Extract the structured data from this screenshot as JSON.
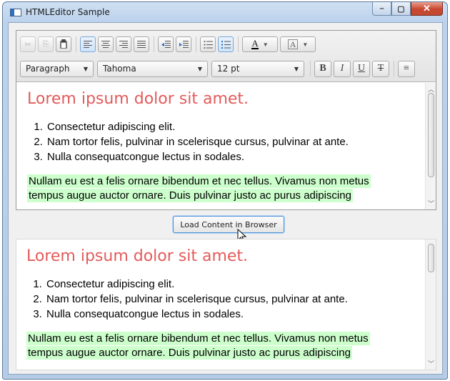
{
  "window": {
    "title": "HTMLEditor Sample",
    "controls": {
      "minimize": "–",
      "maximize": "▢",
      "close": "✕"
    }
  },
  "toolbar": {
    "row1": {
      "cut_icon": "✂",
      "copy_icon": "⎘",
      "paste_icon": "📋",
      "fg_color_label": "A",
      "bg_color_label": "A"
    },
    "row2": {
      "format": "Paragraph",
      "font_family": "Tahoma",
      "font_size": "12 pt",
      "bold": "B",
      "italic": "I",
      "underline": "U",
      "strike": "T",
      "hr": "≡"
    }
  },
  "content": {
    "heading": "Lorem ipsum dolor sit amet.",
    "list": [
      "Consectetur adipiscing elit.",
      "Nam tortor felis, pulvinar in scelerisque cursus, pulvinar at ante.",
      "Nulla consequatcongue lectus in sodales."
    ],
    "paragraph_line1": "Nullam eu est a felis ornare bibendum et nec tellus. Vivamus non metus",
    "paragraph_line2": "tempus augue auctor ornare. Duis pulvinar justo ac purus adipiscing"
  },
  "load_button": {
    "label": "Load Content in Browser"
  },
  "colors": {
    "heading": "#e35b5b",
    "highlight": "#ccffcc",
    "accent": "#4a90d9"
  }
}
